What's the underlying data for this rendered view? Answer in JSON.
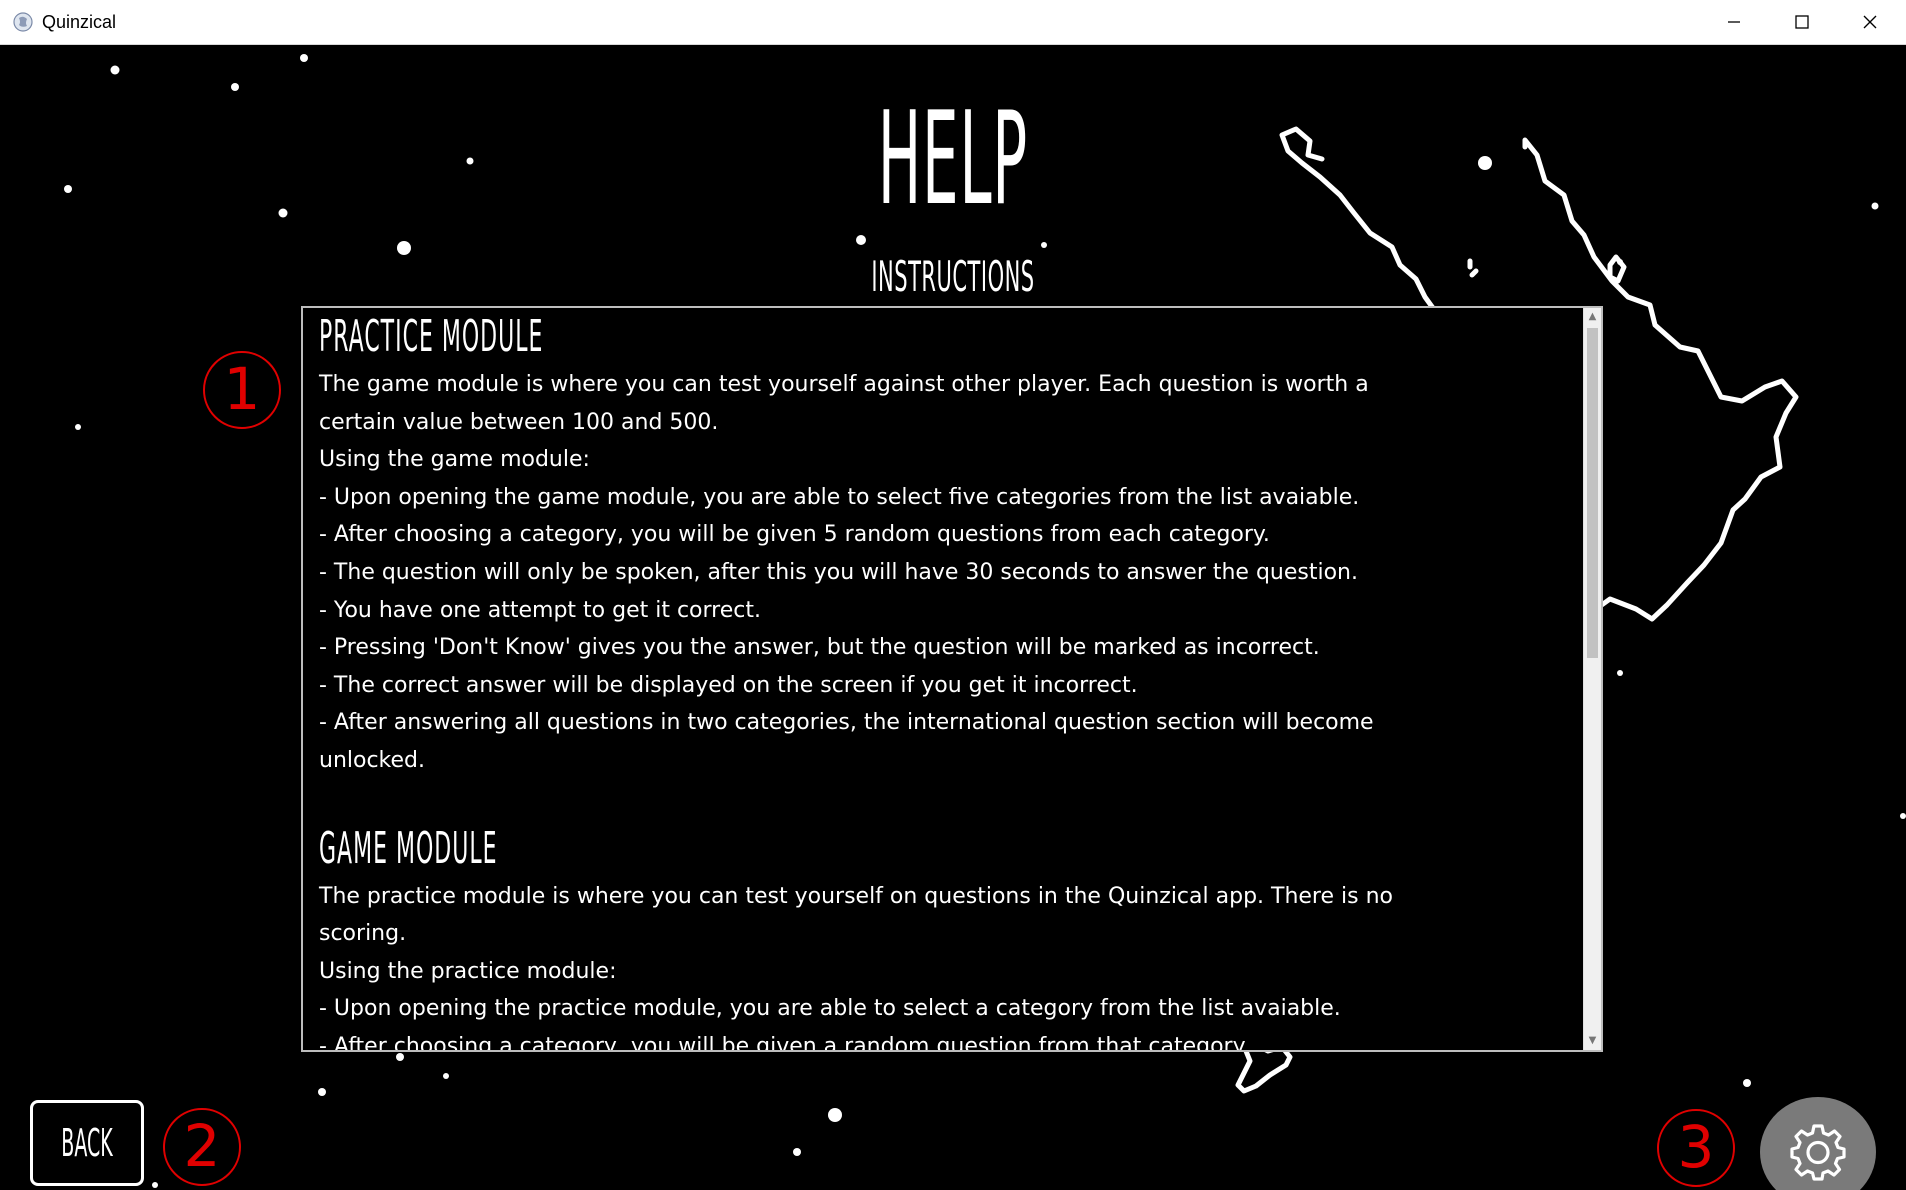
{
  "window": {
    "title": "Quinzical",
    "controls": [
      "minimize-icon",
      "maximize-icon",
      "close-icon"
    ]
  },
  "page": {
    "title": "HELP",
    "subtitle": "INSTRUCTIONS"
  },
  "instructions": {
    "practice_heading": "PRACTICE MODULE",
    "practice_paragraphs": [
      "The game module is where you can test yourself against other player. Each question is worth a certain value between 100 and 500.",
      "Using the game module:",
      "- Upon opening the game module, you are able to select five categories from the list avaiable.",
      "- After choosing a category, you will be given 5 random questions from each category.",
      "- The question will only be spoken, after this you will have 30 seconds to answer the question.",
      "- You have one attempt to get it correct.",
      "- Pressing 'Don't Know' gives you the answer, but the question will be marked as incorrect.",
      "- The correct answer will be displayed on the screen if you get it incorrect.",
      "- After answering all questions in two categories, the international question section will become unlocked."
    ],
    "game_heading": "GAME MODULE",
    "game_paragraphs": [
      "The practice module is where you can test yourself on questions in the Quinzical app. There is no scoring.",
      "Using the practice module:",
      "- Upon opening the practice module, you are able to select a category from the list avaiable.",
      "- After choosing a category, you will be given a random question from that category."
    ]
  },
  "buttons": {
    "back_label": "BACK",
    "settings_icon": "gear-icon"
  },
  "annotations": [
    "1",
    "2",
    "3"
  ],
  "colors": {
    "background": "#000000",
    "text": "#ffffff",
    "annotation": "#e00000",
    "settings_button": "#7a7a7a"
  }
}
